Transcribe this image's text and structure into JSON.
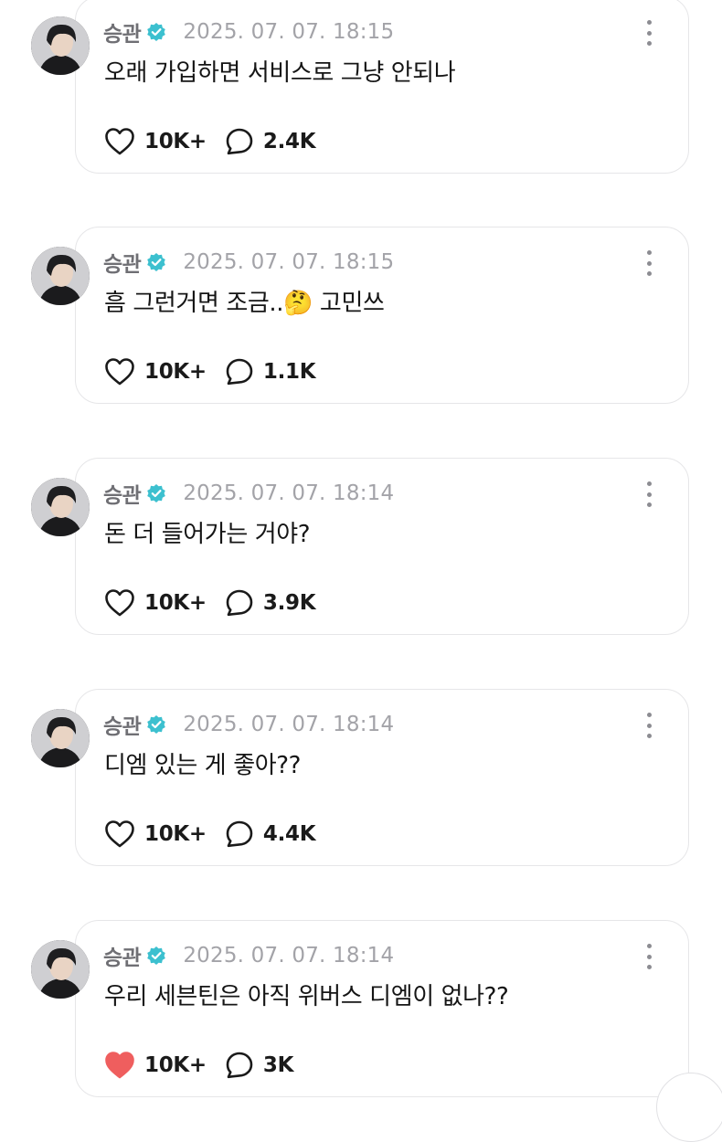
{
  "author": "승관",
  "posts": [
    {
      "timestamp": "2025. 07. 07. 18:15",
      "text": "오래 가입하면 서비스로 그냥 안되나",
      "likes": "10K+",
      "comments": "2.4K",
      "liked": false
    },
    {
      "timestamp": "2025. 07. 07. 18:15",
      "text": "흠 그런거면 조금..🤔 고민쓰",
      "likes": "10K+",
      "comments": "1.1K",
      "liked": false
    },
    {
      "timestamp": "2025. 07. 07. 18:14",
      "text": "돈 더 들어가는 거야?",
      "likes": "10K+",
      "comments": "3.9K",
      "liked": false
    },
    {
      "timestamp": "2025. 07. 07. 18:14",
      "text": "디엠 있는 게 좋아??",
      "likes": "10K+",
      "comments": "4.4K",
      "liked": false
    },
    {
      "timestamp": "2025. 07. 07. 18:14",
      "text": "우리 세븐틴은 아직 위버스 디엠이 없나??",
      "likes": "10K+",
      "comments": "3K",
      "liked": true
    }
  ],
  "icons": {
    "verified": "verified-badge-icon",
    "more": "more-vertical-icon",
    "like": "heart-icon",
    "comment": "comment-bubble-icon"
  },
  "colors": {
    "verified": "#3cc0cf",
    "liked_heart": "#ef5e5e",
    "author": "#6f6f74",
    "timestamp": "#a3a3a8"
  }
}
